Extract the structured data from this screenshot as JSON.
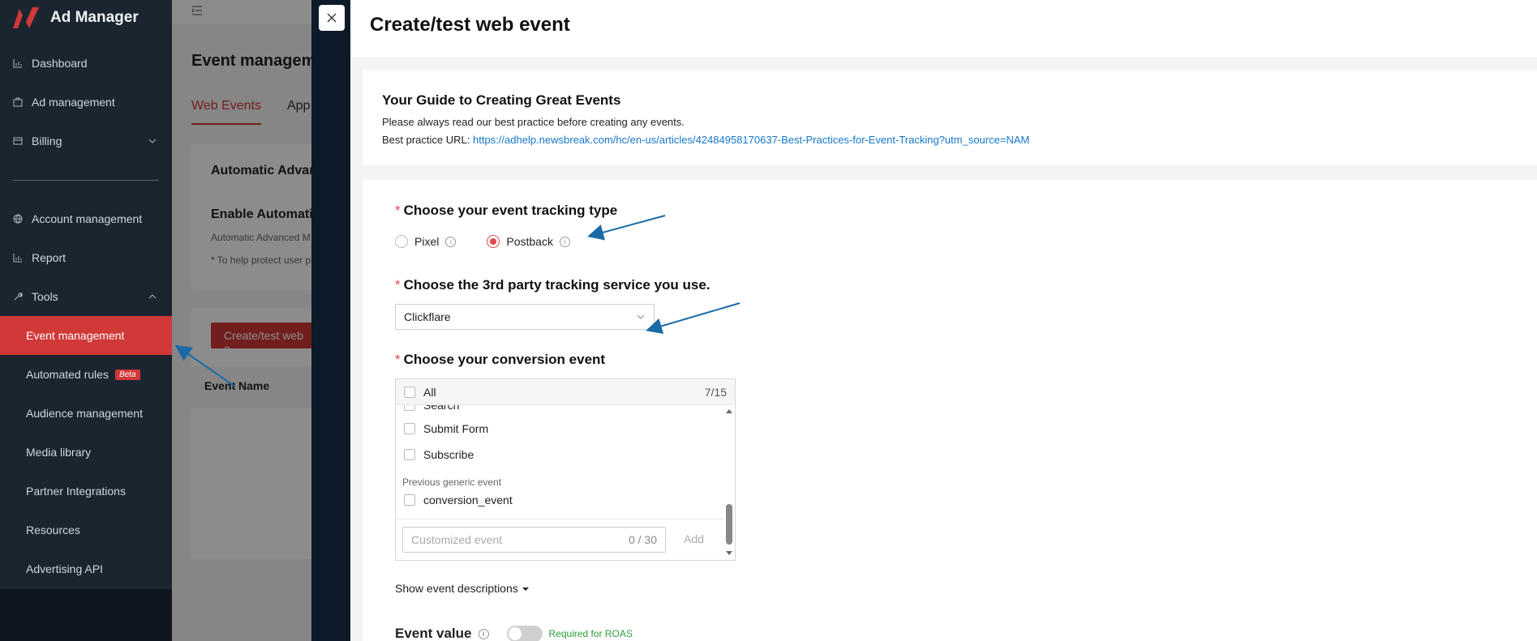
{
  "app": {
    "name": "Ad Manager"
  },
  "sidebar": {
    "items": [
      {
        "label": "Dashboard",
        "icon": "chart-icon"
      },
      {
        "label": "Ad management",
        "icon": "briefcase-icon"
      },
      {
        "label": "Billing",
        "icon": "card-icon"
      },
      {
        "label": "Account management",
        "icon": "globe-icon"
      },
      {
        "label": "Report",
        "icon": "chart-icon"
      },
      {
        "label": "Tools",
        "icon": "wrench-icon"
      }
    ],
    "tools_sub": [
      {
        "label": "Event management",
        "active": true
      },
      {
        "label": "Automated rules",
        "badge": "Beta"
      },
      {
        "label": "Audience management"
      },
      {
        "label": "Media library"
      },
      {
        "label": "Partner Integrations"
      },
      {
        "label": "Resources"
      },
      {
        "label": "Advertising API"
      }
    ]
  },
  "background": {
    "title": "Event manageme",
    "tabs": [
      "Web Events",
      "App"
    ],
    "card_title": "Automatic Advan",
    "card_subtitle": "Enable Automatic",
    "card_desc": "Automatic Advanced M",
    "card_note": "* To help protect user p",
    "create_button": "Create/test web e",
    "col_event_name": "Event Name"
  },
  "drawer": {
    "title": "Create/test web event",
    "guide": {
      "heading": "Your Guide to Creating Great Events",
      "line1": "Please always read our best practice before creating any events.",
      "url_label": "Best practice URL: ",
      "url": "https://adhelp.newsbreak.com/hc/en-us/articles/42484958170637-Best-Practices-for-Event-Tracking?utm_source=NAM"
    },
    "tracking_type": {
      "label": "Choose your event tracking type",
      "options": [
        "Pixel",
        "Postback"
      ],
      "selected": "Postback"
    },
    "third_party": {
      "label": "Choose the 3rd party tracking service you use.",
      "value": "Clickflare"
    },
    "conversion": {
      "label": "Choose your conversion event",
      "all_label": "All",
      "count": "7/15",
      "items": [
        "Search",
        "Submit Form",
        "Subscribe"
      ],
      "group_label": "Previous generic event",
      "group_items": [
        "conversion_event"
      ],
      "custom_placeholder": "Customized event",
      "custom_count": "0 / 30",
      "add_label": "Add"
    },
    "show_desc": "Show event descriptions",
    "event_value": {
      "label": "Event value",
      "hint": "Required for ROAS"
    }
  },
  "colors": {
    "accent": "#d13838",
    "link": "#1677c9",
    "sidebar_bg": "#1b2530",
    "annotation": "#1a6aa8"
  }
}
